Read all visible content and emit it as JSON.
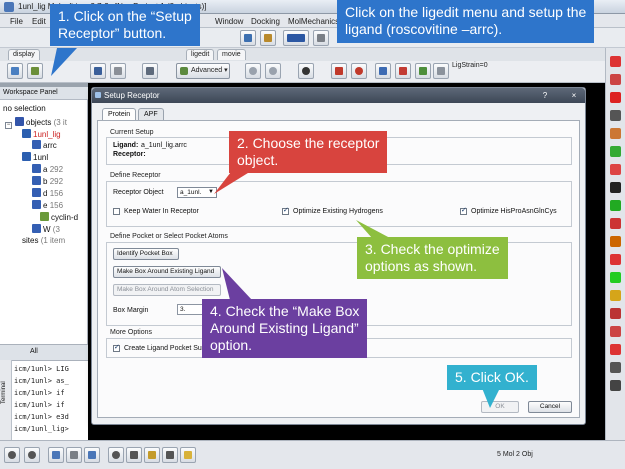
{
  "window": {
    "title": "1unl_lig Molsoft icm 3.7-2c [NewProject 1 (2 objects)]"
  },
  "menu": {
    "items": [
      "File",
      "Edit",
      "MolMechanics"
    ],
    "docking": "Docking",
    "window": "Window"
  },
  "tabs": [
    "display",
    "ligedit",
    "movie"
  ],
  "toolbar": {
    "advanced_label": "Advanced",
    "ligstrain": "LigStrain=0"
  },
  "workspace": {
    "header": "Workspace Panel",
    "selection": "no selection",
    "tree": [
      {
        "label": "objects",
        "count": "(3 it"
      },
      {
        "label": "1unl_lig",
        "count": ""
      },
      {
        "label": "arrc",
        "count": ""
      },
      {
        "label": "1unl",
        "count": ""
      },
      {
        "label": "a",
        "count": "292"
      },
      {
        "label": "b",
        "count": "292"
      },
      {
        "label": "d",
        "count": "156"
      },
      {
        "label": "e",
        "count": "156"
      },
      {
        "label": "cyclin-d",
        "count": ""
      },
      {
        "label": "W",
        "count": "(3"
      },
      {
        "label": "sites",
        "count": "(1 item"
      }
    ],
    "bottom_tabs": [
      "All"
    ]
  },
  "terminal": {
    "label": "Terminal",
    "lines": [
      "icm/1unl> LIG",
      "icm/1unl> as_",
      "icm/1unl> if",
      "icm/1unl> if",
      "icm/1unl> e3d",
      "icm/1unl_lig>"
    ]
  },
  "status": {
    "text": "5 Mol 2 Obj"
  },
  "dialog": {
    "title": "Setup Receptor",
    "help": "?",
    "close": "×",
    "tabs": [
      "Protein",
      "APF"
    ],
    "current_setup": {
      "title": "Current Setup",
      "ligand_label": "Ligand:",
      "ligand_value": "a_1unl_lig.arrc",
      "receptor_label": "Receptor:"
    },
    "define_receptor": {
      "title": "Define Receptor",
      "receptor_object_label": "Receptor Object",
      "receptor_object_value": "a_1unl.",
      "keep_water": "Keep Water In Receptor",
      "keep_water_checked": false,
      "optimize_h": "Optimize Existing Hydrogens",
      "optimize_h_checked": true,
      "optimize_his": "Optimize HisProAsnGlnCys",
      "optimize_his_checked": true
    },
    "define_pocket": {
      "title": "Define Pocket or Select Pocket Atoms",
      "identify_btn": "Identify Pocket Box",
      "make_box_btn": "Make Box Around Existing Ligand",
      "make_box_sel_btn": "Make Box Around Atom Selection",
      "margin_label": "Box Margin",
      "margin_value": "3."
    },
    "more_options": {
      "title": "More Options",
      "create_label": "Create Ligand Pocket Su",
      "create_checked": true
    },
    "ok": "OK",
    "cancel": "Cancel"
  },
  "callouts": {
    "c1": "1. Click on the “Setup",
    "c1b": "Receptor” button.",
    "top_a": "Click on the ligedit menu and setup the",
    "top_b": "ligand (roscovitine –arrc).",
    "c2a": "2. Choose the receptor",
    "c2b": "object.",
    "c3a": "3. Check the optimize",
    "c3b": "options as shown.",
    "c4a": "4. Check the “Make Box",
    "c4b": "Around Existing Ligand”",
    "c4c": "option.",
    "c5": "5. Click OK."
  },
  "colors": {
    "callout_blue": "#2e75cb",
    "callout_red": "#d8443e",
    "callout_green": "#8dbf3f",
    "callout_purple": "#6b3fa0",
    "callout_teal": "#32b1cf"
  }
}
